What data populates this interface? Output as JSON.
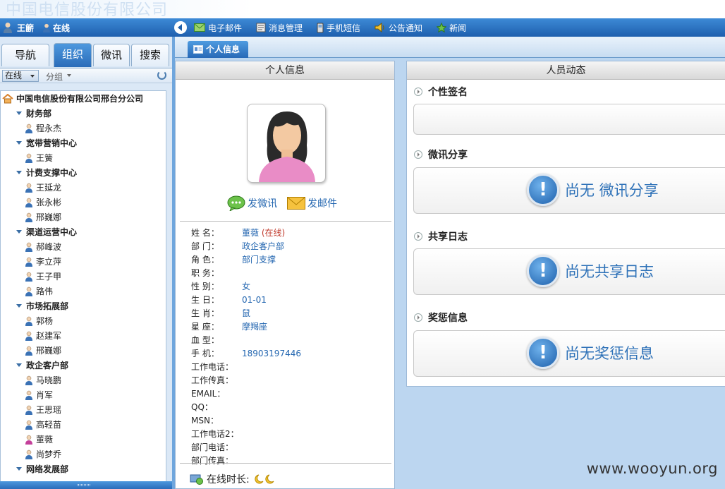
{
  "app": {
    "banner_text": "中国电信股份有限公司"
  },
  "user": {
    "name": "王簖",
    "status": "在线"
  },
  "toolbar": {
    "items": [
      {
        "label": "电子邮件",
        "icon": "mail-icon"
      },
      {
        "label": "消息管理",
        "icon": "message-manage-icon"
      },
      {
        "label": "手机短信",
        "icon": "mobile-sms-icon"
      },
      {
        "label": "公告通知",
        "icon": "speaker-icon"
      },
      {
        "label": "新闻",
        "icon": "news-icon"
      }
    ]
  },
  "left": {
    "tabs": [
      "导航",
      "组织",
      "微讯",
      "搜索"
    ],
    "active_tab": "组织",
    "filter_online": "在线",
    "filter_group": "分组",
    "tree": [
      {
        "type": "root",
        "label": "中国电信股份有限公司邢台分公司"
      },
      {
        "type": "dept",
        "label": "财务部"
      },
      {
        "type": "user",
        "label": "程永杰"
      },
      {
        "type": "dept",
        "label": "宽带营销中心"
      },
      {
        "type": "user",
        "label": "王簧"
      },
      {
        "type": "dept",
        "label": "计费支撑中心"
      },
      {
        "type": "user",
        "label": "王延龙"
      },
      {
        "type": "user",
        "label": "张永彬"
      },
      {
        "type": "user",
        "label": "邢巍娜"
      },
      {
        "type": "dept",
        "label": "渠道运营中心"
      },
      {
        "type": "user",
        "label": "郝峰波"
      },
      {
        "type": "user",
        "label": "李立萍"
      },
      {
        "type": "user",
        "label": "王子甲"
      },
      {
        "type": "user",
        "label": "路伟"
      },
      {
        "type": "dept",
        "label": "市场拓展部"
      },
      {
        "type": "user",
        "label": "郭杨"
      },
      {
        "type": "user",
        "label": "赵建军"
      },
      {
        "type": "user",
        "label": "邢巍娜"
      },
      {
        "type": "dept",
        "label": "政企客户部"
      },
      {
        "type": "user",
        "label": "马晓鹏"
      },
      {
        "type": "user",
        "label": "肖军"
      },
      {
        "type": "user",
        "label": "王思瑶"
      },
      {
        "type": "user",
        "label": "高轻苗"
      },
      {
        "type": "user-f",
        "label": "董薇"
      },
      {
        "type": "user",
        "label": "尚梦乔"
      },
      {
        "type": "dept",
        "label": "网络发展部"
      }
    ]
  },
  "doc_tab": {
    "label": "个人信息"
  },
  "info_panel": {
    "title": "个人信息",
    "actions": {
      "weixun": "发微讯",
      "email": "发邮件"
    },
    "fields": [
      {
        "label": "姓 名：",
        "value": "董薇",
        "extra": "(在线)"
      },
      {
        "label": "部 门：",
        "value": "政企客户部"
      },
      {
        "label": "角 色：",
        "value": "部门支撑"
      },
      {
        "label": "职 务：",
        "value": ""
      },
      {
        "label": "性 别：",
        "value": "女"
      },
      {
        "label": "生 日：",
        "value": "01-01"
      },
      {
        "label": "生 肖：",
        "value": "鼠"
      },
      {
        "label": "星 座：",
        "value": "摩羯座"
      },
      {
        "label": "血 型：",
        "value": ""
      },
      {
        "label": "手 机：",
        "value": "18903197446"
      },
      {
        "label": "工作电话：",
        "value": ""
      },
      {
        "label": "工作传真：",
        "value": ""
      },
      {
        "label": "EMAIL：",
        "value": ""
      },
      {
        "label": "QQ：",
        "value": ""
      },
      {
        "label": "MSN：",
        "value": ""
      },
      {
        "label": "工作电话2：",
        "value": ""
      },
      {
        "label": "部门电话：",
        "value": ""
      },
      {
        "label": "部门传真：",
        "value": ""
      }
    ],
    "online_time_label": "在线时长:"
  },
  "dynamics_panel": {
    "title": "人员动态",
    "sections": [
      {
        "title": "个性签名",
        "empty_text": ""
      },
      {
        "title": "微讯分享",
        "empty_text": "尚无 微讯分享"
      },
      {
        "title": "共享日志",
        "empty_text": "尚无共享日志"
      },
      {
        "title": "奖惩信息",
        "empty_text": "尚无奖惩信息"
      }
    ]
  },
  "watermark": "www.wooyun.org",
  "colors": {
    "accent": "#2a6cb9",
    "link": "#2366b0",
    "online_status": "#c0392b"
  }
}
